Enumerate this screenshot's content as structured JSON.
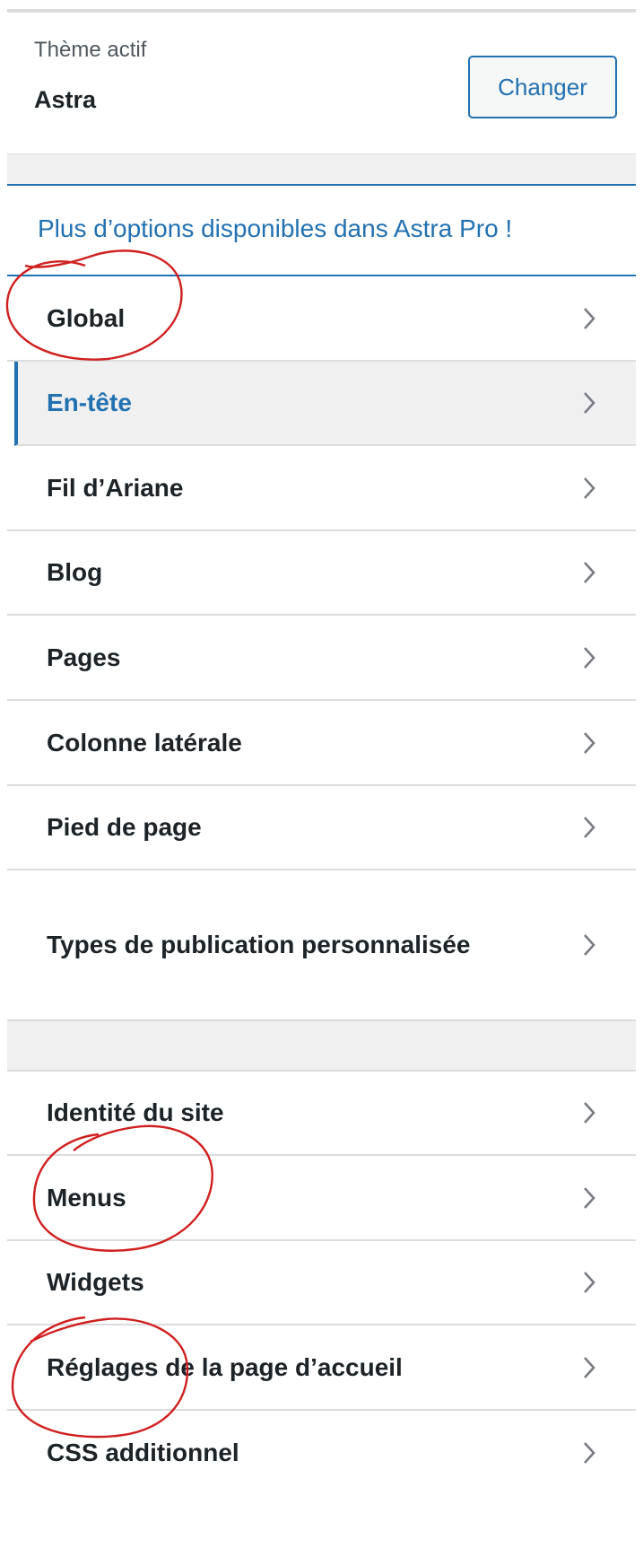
{
  "theme": {
    "caption": "Thème actif",
    "name": "Astra",
    "change_label": "Changer"
  },
  "promo": {
    "text": "Plus d’options disponibles dans Astra Pro !"
  },
  "sections": [
    {
      "label": "Global",
      "highlighted": false
    },
    {
      "label": "En-tête",
      "highlighted": true
    },
    {
      "label": "Fil d’Ariane",
      "highlighted": false
    },
    {
      "label": "Blog",
      "highlighted": false
    },
    {
      "label": "Pages",
      "highlighted": false
    },
    {
      "label": "Colonne latérale",
      "highlighted": false
    },
    {
      "label": "Pied de page",
      "highlighted": false
    },
    {
      "label": "Types de publication personnalisée",
      "highlighted": false
    }
  ],
  "core_sections": [
    {
      "label": "Identité du site"
    },
    {
      "label": "Menus"
    },
    {
      "label": "Widgets"
    },
    {
      "label": "Réglages de la page d’accueil"
    },
    {
      "label": "CSS additionnel"
    }
  ],
  "colors": {
    "accent": "#2271b1",
    "annotation": "#d01f1f",
    "separator": "#f0f0f1",
    "border": "#dcdcde"
  },
  "icons": {
    "chevron": "chevron-right-icon"
  }
}
